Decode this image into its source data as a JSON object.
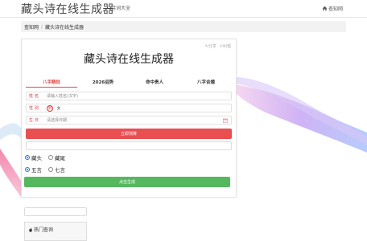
{
  "header": {
    "site_title": "藏头诗在线生成器",
    "nav_link": "诗词大全",
    "home_link": "查知网"
  },
  "breadcrumb": {
    "home": "查知网",
    "separator": "/",
    "current": "藏头诗在线生成器"
  },
  "card": {
    "actions": {
      "share": "分享",
      "edit": "纠错"
    },
    "title": "藏头诗在线生成器",
    "tabs": [
      {
        "label": "八字精批",
        "active": true
      },
      {
        "label": "2026运势",
        "active": false
      },
      {
        "label": "命中贵人",
        "active": false
      },
      {
        "label": "八字合婚",
        "active": false
      }
    ],
    "name_field": {
      "label": "姓名",
      "placeholder": "请输入姓名(汉字)"
    },
    "gender_field": {
      "label": "性别",
      "male": "男",
      "female": "女",
      "selected": "男"
    },
    "birth_field": {
      "label": "生日",
      "placeholder": "请选择日期"
    },
    "submit_label": "立即测算",
    "position_options": {
      "selected": "藏头",
      "options": [
        "藏头",
        "藏尾"
      ]
    },
    "length_options": {
      "selected": "五言",
      "options": [
        "五言",
        "七言"
      ]
    },
    "generate_label": "点击生成"
  },
  "sidebar": {
    "hot_title": "热门查询"
  },
  "colors": {
    "accent_red": "#e94e50",
    "accent_green": "#55b85f",
    "tab_active": "#e04848",
    "radio_on": "#2a6fdb"
  }
}
